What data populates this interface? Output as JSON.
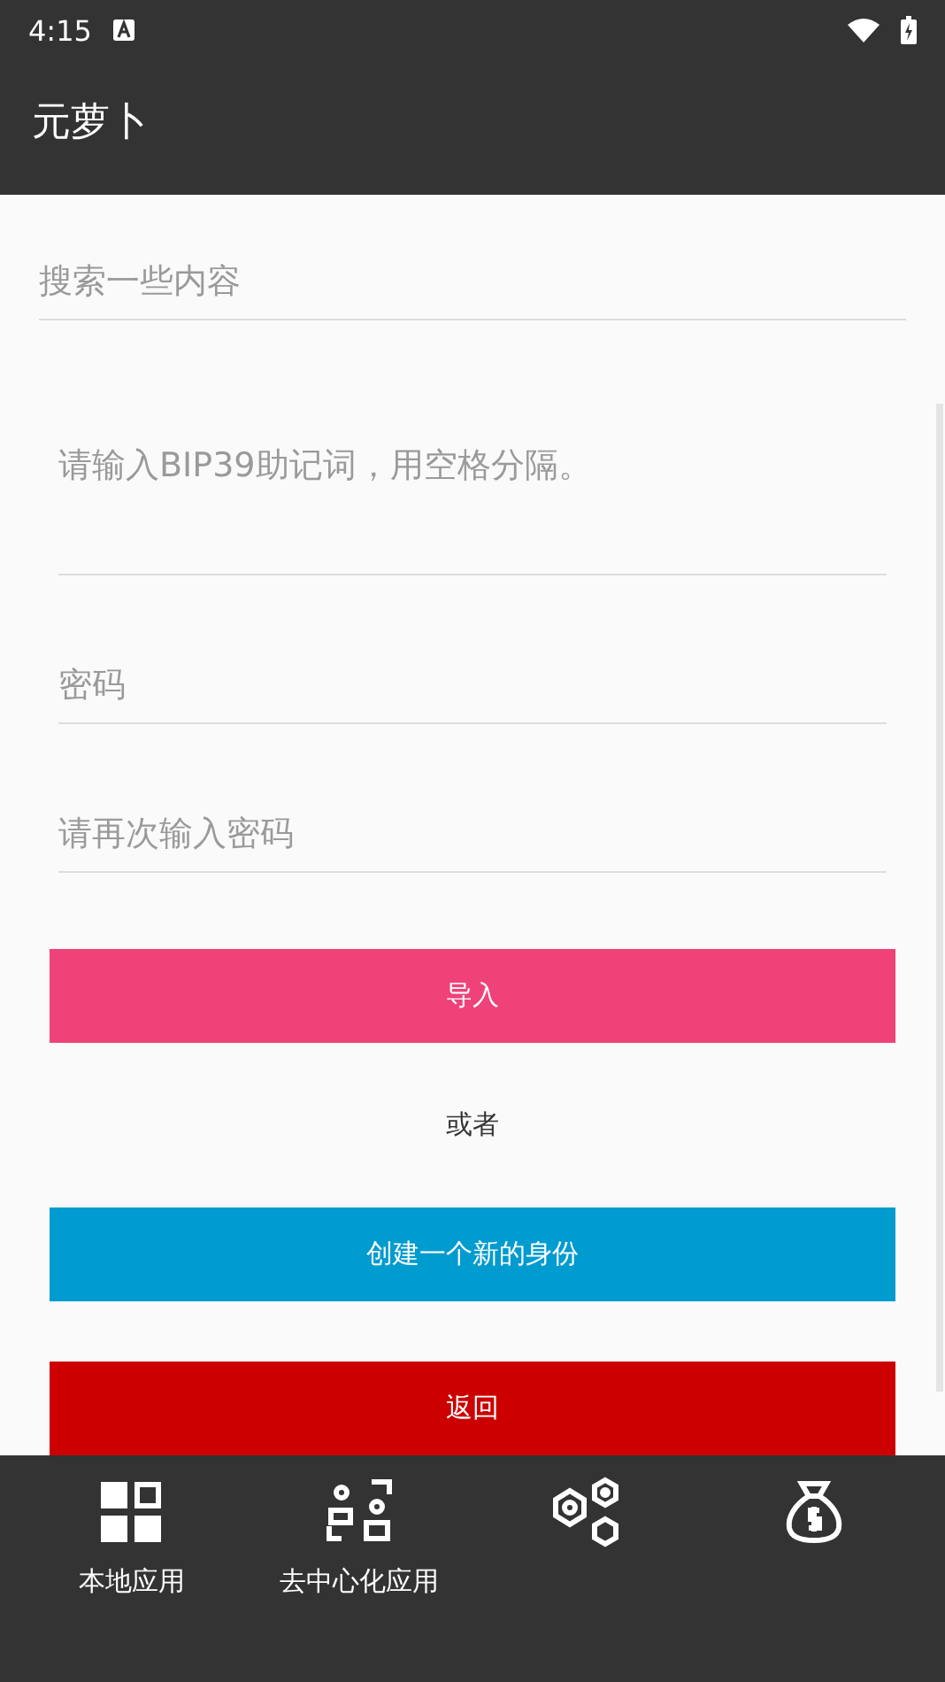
{
  "status_bar": {
    "time": "4:15"
  },
  "app_bar": {
    "title": "元萝卜"
  },
  "search": {
    "placeholder": "搜索一些内容"
  },
  "form": {
    "fields": [
      {
        "placeholder": "请输入BIP39助记词，用空格分隔。",
        "kind": "multiline"
      },
      {
        "placeholder": "密码",
        "kind": "password"
      },
      {
        "placeholder": "请再次输入密码",
        "kind": "password"
      }
    ],
    "buttons": [
      {
        "label": "导入",
        "color": "#ee4279"
      },
      {
        "label": "创建一个新的身份",
        "color": "#009bcf"
      },
      {
        "label": "返回",
        "color": "#cc0000"
      }
    ],
    "separator": "或者"
  },
  "bottom_nav": [
    {
      "label": "本地应用",
      "kind": "grid"
    },
    {
      "label": "去中心化应用",
      "kind": "people"
    },
    {
      "kind": "hexagons"
    },
    {
      "kind": "moneybag"
    }
  ]
}
